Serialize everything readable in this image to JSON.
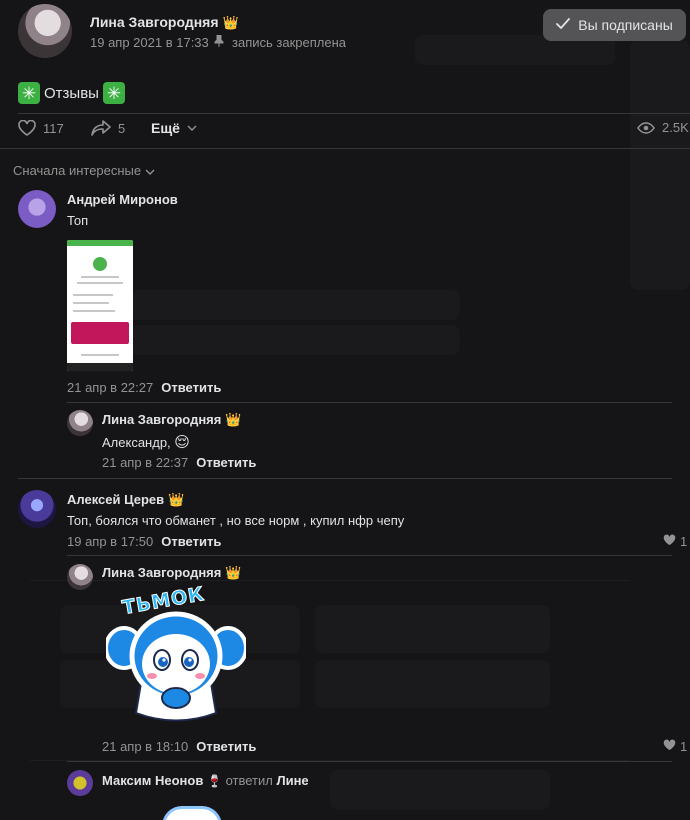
{
  "post": {
    "author": "Лина Завгородняя",
    "crown": "👑",
    "date": "19 апр 2021 в 17:33",
    "pinned_label": "запись закреплена",
    "subscribe_label": "Вы подписаны",
    "title": "Отзывы",
    "likes": "117",
    "shares": "5",
    "more_label": "Ещё",
    "views": "2.5K"
  },
  "sort_label": "Сначала интересные",
  "comments": [
    {
      "author": "Андрей Миронов",
      "text": "Топ",
      "date": "21 апр в 22:27",
      "reply_label": "Ответить",
      "has_image": true
    },
    {
      "author": "Лина Завгородняя",
      "crown": "👑",
      "text": "Александр,",
      "emoji": "😌",
      "date": "21 апр в 22:37",
      "reply_label": "Ответить"
    },
    {
      "author": "Алексей Церев",
      "crown": "👑",
      "text": "Топ, боялся что обманет , но все норм , купил нфр чепу",
      "date": "19 апр в 17:50",
      "reply_label": "Ответить",
      "likes": "1"
    },
    {
      "author": "Лина Завгородняя",
      "crown": "👑",
      "sticker_text": "ТЬМОК",
      "date": "21 апр в 18:10",
      "reply_label": "Ответить",
      "likes": "1"
    },
    {
      "author": "Максим Неонов",
      "badge": "🍷",
      "replied_label": "ответил",
      "replied_to": "Лине"
    }
  ],
  "colors": {
    "background": "#151416",
    "text": "#e1e3e6",
    "secondary": "#939393",
    "button": "#545456",
    "crown": "#f0b627",
    "sparkle": "#3cb043"
  }
}
